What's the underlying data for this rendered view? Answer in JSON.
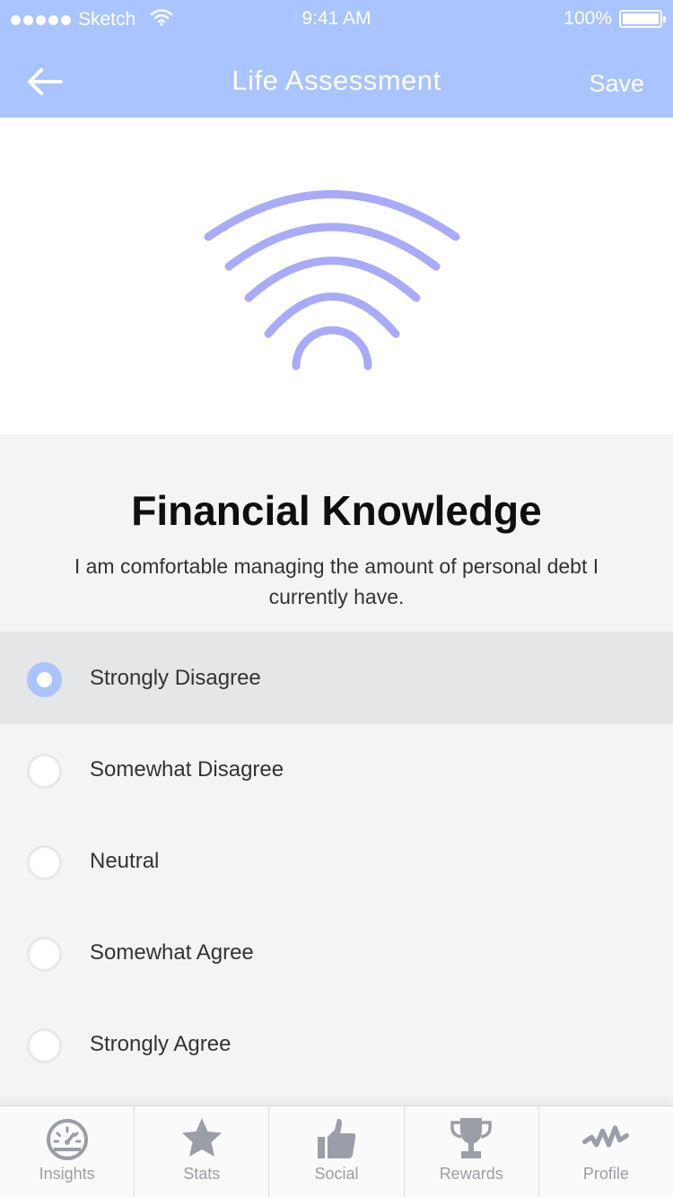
{
  "status_bar": {
    "carrier": "Sketch",
    "time": "9:41 AM",
    "battery": "100%"
  },
  "nav": {
    "title": "Life Assessment",
    "save_label": "Save"
  },
  "question": {
    "category": "Financial Knowledge",
    "text": "I am comfortable managing the amount of personal debt I currently have."
  },
  "options": [
    {
      "label": "Strongly Disagree",
      "selected": true
    },
    {
      "label": "Somewhat Disagree",
      "selected": false
    },
    {
      "label": "Neutral",
      "selected": false
    },
    {
      "label": "Somewhat Agree",
      "selected": false
    },
    {
      "label": "Strongly Agree",
      "selected": false
    }
  ],
  "tabs": [
    {
      "label": "Insights",
      "icon": "gauge-icon"
    },
    {
      "label": "Stats",
      "icon": "star-icon"
    },
    {
      "label": "Social",
      "icon": "thumbs-up-icon"
    },
    {
      "label": "Rewards",
      "icon": "trophy-icon"
    },
    {
      "label": "Profile",
      "icon": "activity-icon"
    }
  ],
  "colors": {
    "accent": "#a9c4ff",
    "illustration": "#a9aaf8",
    "tab_icon": "#9a9ea6"
  }
}
